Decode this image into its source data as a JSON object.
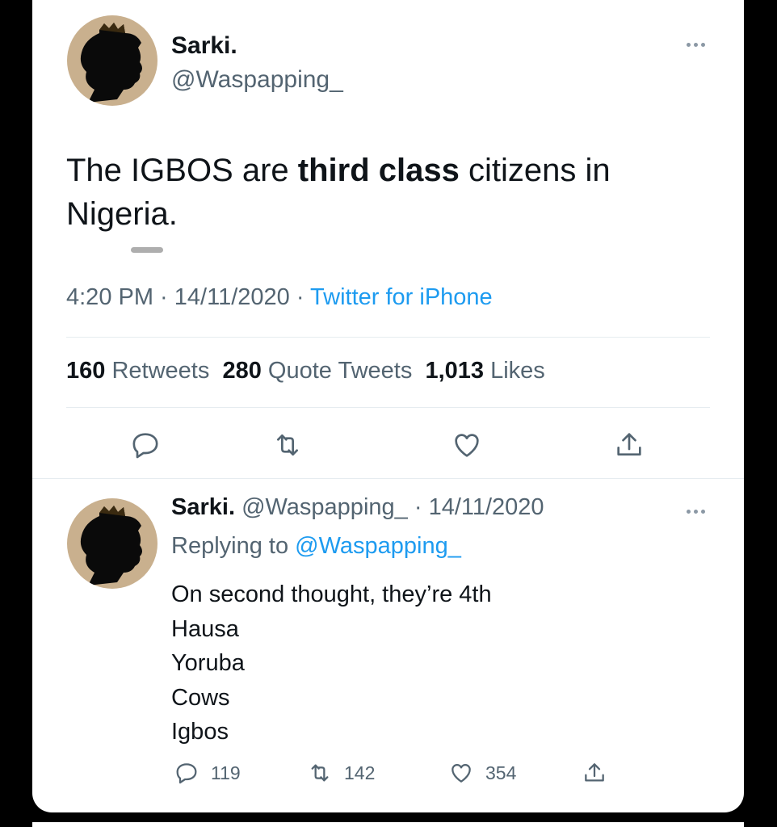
{
  "tweet": {
    "display_name": "Sarki.",
    "handle": "@Waspapping_",
    "text_before": "The IGBOS are ",
    "text_bold": "third class",
    "text_after": " citizens in Nigeria.",
    "time": "4:20 PM",
    "date": "14/11/2020",
    "source": "Twitter for iPhone",
    "stats": {
      "retweets_count": "160",
      "retweets_label": "Retweets",
      "quotes_count": "280",
      "quotes_label": "Quote Tweets",
      "likes_count": "1,013",
      "likes_label": "Likes"
    },
    "actions": [
      "reply-icon",
      "retweet-icon",
      "like-icon",
      "share-icon"
    ]
  },
  "reply": {
    "display_name": "Sarki.",
    "handle": "@Waspapping_",
    "date": "14/11/2020",
    "replying_label": "Replying to",
    "replying_to": "@Waspapping_",
    "lines": [
      "On second thought, they’re 4th",
      "Hausa",
      "Yoruba",
      "Cows",
      "Igbos"
    ],
    "counts": {
      "replies": "119",
      "retweets": "142",
      "likes": "354"
    }
  },
  "colors": {
    "link": "#1d9bf0",
    "muted": "#536471",
    "text": "#0f1419",
    "avatar_bg": "#c9b08e"
  }
}
